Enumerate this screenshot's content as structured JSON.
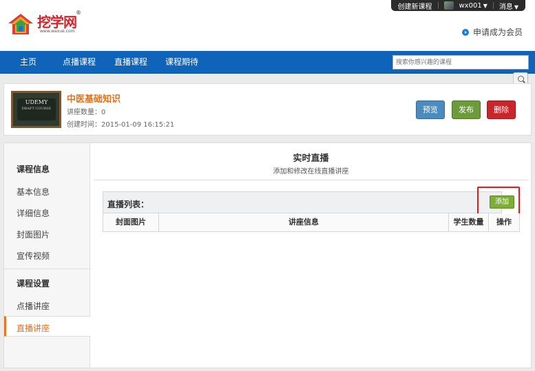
{
  "topbar": {
    "create_course": "创建新课程",
    "username": "wx001",
    "messages": "消息"
  },
  "header": {
    "logo_text": "挖学网",
    "logo_url": "www.waxue.com",
    "member_link": "申请成为会员"
  },
  "nav": {
    "items": [
      "主页",
      "点播课程",
      "直播课程",
      "课程期待"
    ],
    "search_placeholder": "搜索你感兴趣的课程"
  },
  "course": {
    "thumb_title": "UDEMY",
    "thumb_sub": "DRAFT COURSE",
    "title": "中医基础知识",
    "lecture_count": "讲座数量：0",
    "created": "创建时间：2015-01-09 16:15:21",
    "buttons": {
      "preview": "预览",
      "publish": "发布",
      "delete": "删除"
    }
  },
  "sidebar": {
    "section1": "课程信息",
    "items1": [
      "基本信息",
      "详细信息",
      "封面图片",
      "宣传视频"
    ],
    "section2": "课程设置",
    "items2": [
      "点播讲座",
      "直播讲座"
    ]
  },
  "main": {
    "title": "实时直播",
    "subtitle": "添加和修改在线直播讲座",
    "list_label": "直播列表：",
    "add_button": "添加",
    "columns": [
      "封面图片",
      "讲座信息",
      "学生数量",
      "操作"
    ]
  },
  "colors": {
    "nav": "#0f63b8",
    "accent": "#e0731f",
    "add": "#7fae38",
    "highlight": "#d9201e"
  }
}
